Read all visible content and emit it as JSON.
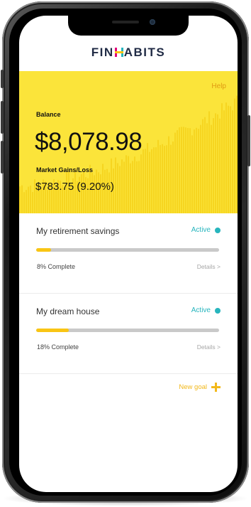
{
  "brand": {
    "name_before": "FIN",
    "name_mark": "H",
    "name_after": "ABITS",
    "icon": "finhabits-logo-icon",
    "colors": {
      "navy": "#1f2a44",
      "yellow": "#fbe43a",
      "accent_orange": "#e09a12",
      "teal": "#27b5bd"
    }
  },
  "header": {
    "help_label": "Help"
  },
  "balance": {
    "label": "Balance",
    "value": "$8,078.98"
  },
  "market": {
    "label": "Market Gains/Loss",
    "value": "$783.75 (9.20%)"
  },
  "goals": [
    {
      "title": "My retirement savings",
      "status": "Active",
      "progress": 0.08,
      "complete_label": "8% Complete",
      "details_label": "Details >"
    },
    {
      "title": "My dream house",
      "status": "Active",
      "progress": 0.18,
      "complete_label": "18% Complete",
      "details_label": "Details >"
    }
  ],
  "actions": {
    "new_goal_label": "New goal",
    "new_goal_icon": "plus-icon"
  }
}
